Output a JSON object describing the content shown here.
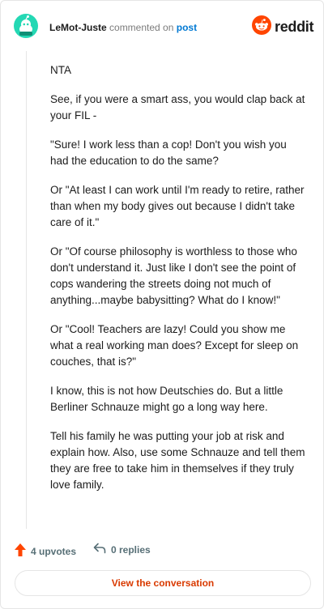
{
  "header": {
    "username": "LeMot-Juste",
    "action": "commented on",
    "target": "post",
    "logo_text": "reddit"
  },
  "comment": {
    "paragraphs": [
      "NTA",
      "See, if you were a smart ass, you would clap back at your FIL -",
      "\"Sure! I work less than a cop! Don't you wish you had the education to do the same?",
      "Or \"At least I can work until I'm ready to retire, rather than when my body gives out because I didn't take care of it.\"",
      "Or \"Of course philosophy is worthless to those who don't understand it. Just like I don't see the point of cops wandering the streets doing not much of anything...maybe babysitting? What do I know!\"",
      "Or \"Cool! Teachers are lazy! Could you show me what a real working man does? Except for sleep on couches, that is?\"",
      "I know, this is not how Deutschies do. But a little Berliner Schnauze might go a long way here.",
      "Tell his family he was putting your job at risk and explain how. Also, use some Schnauze and tell them they are free to take him in themselves if they truly love family."
    ]
  },
  "footer": {
    "upvotes": "4 upvotes",
    "replies": "0 replies",
    "view_button": "View the conversation"
  },
  "colors": {
    "accent": "#ff4500",
    "link": "#0079d3",
    "button_text": "#d93a00",
    "avatar": "#24d8b4"
  },
  "icons": {
    "avatar": "snoo-avatar-icon",
    "logo": "reddit-snoo-icon",
    "upvote": "upvote-arrow-icon",
    "reply": "reply-arrow-icon"
  }
}
